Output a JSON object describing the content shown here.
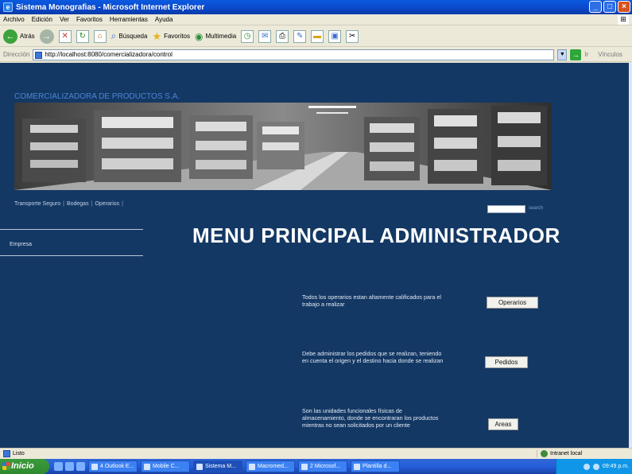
{
  "window": {
    "title": "Sistema Monografias - Microsoft Internet Explorer",
    "min": "_",
    "max": "□",
    "close": "×"
  },
  "menubar": [
    "Archivo",
    "Edición",
    "Ver",
    "Favoritos",
    "Herramientas",
    "Ayuda"
  ],
  "toolbar": {
    "back": "Atrás",
    "search": "Búsqueda",
    "favorites": "Favoritos",
    "multimedia": "Multimedia"
  },
  "address": {
    "label": "Dirección",
    "url": "http://localhost:8080/comercializadora/control",
    "go": "Ir",
    "links": "Vínculos"
  },
  "page": {
    "company": "COMERCIALIZADORA DE PRODUCTOS S.A.",
    "nav": [
      "Transporte Seguro",
      "Bodegas",
      "Operarios"
    ],
    "search_label": "search",
    "sidebar_item": "Empresa",
    "title": "MENU PRINCIPAL ADMINISTRADOR",
    "options": [
      {
        "desc": "Todos los operarios estan altamente calificados para el trabajo a realizar",
        "button": "Operarios"
      },
      {
        "desc": "Debe administrar los pedidos que se realizan, teniendo en cuenta el origen y el destino hacia donde se realizan",
        "button": "Pedidos"
      },
      {
        "desc": "Son las unidades funcionales físicas de almacenamiento, donde se encontraran los productos mientras no sean solicitados por un cliente",
        "button": "Areas"
      }
    ]
  },
  "status": {
    "text": "Listo",
    "zone": "Intranet local"
  },
  "taskbar": {
    "start": "Inicio",
    "tasks": [
      "4 Outlook E...",
      "Mobile C...",
      "Sistema M...",
      "Macromed...",
      "2 Microsof...",
      "Plantilla d..."
    ],
    "clock": "09:49 p.m."
  },
  "colors": {
    "page_bg": "#143864",
    "company_text": "#4b86d6",
    "title_text": "#ffffff"
  }
}
